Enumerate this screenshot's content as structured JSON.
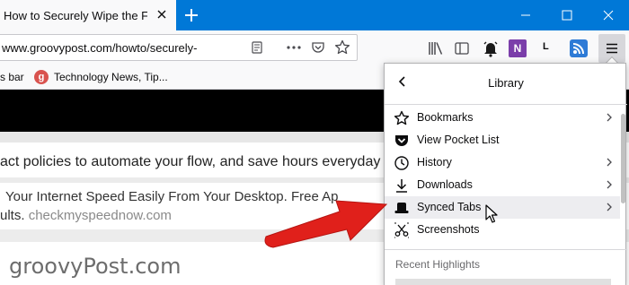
{
  "tab": {
    "title": "How to Securely Wipe the Free"
  },
  "navbar": {
    "url": "www.groovypost.com/howto/securely-"
  },
  "bookmarks": {
    "item1": "s bar",
    "favicon_letter": "g",
    "item2": "Technology News, Tip..."
  },
  "toolbar_icons": {
    "letter_icon": "L",
    "onenote_letter": "N"
  },
  "content": {
    "line_policies": "act policies to automate your flow, and save hours everyday",
    "line_speed": "Your Internet Speed Easily From Your Desktop. Free Ap",
    "line_results_prefix": "ults. ",
    "line_results_link": "checkmyspeednow.com",
    "watermark": "groovyPost.com"
  },
  "library": {
    "title": "Library",
    "items": [
      {
        "label": "Bookmarks",
        "icon": "bookmarks-icon",
        "submenu": true
      },
      {
        "label": "View Pocket List",
        "icon": "pocket-icon",
        "submenu": false
      },
      {
        "label": "History",
        "icon": "history-icon",
        "submenu": true
      },
      {
        "label": "Downloads",
        "icon": "downloads-icon",
        "submenu": true
      },
      {
        "label": "Synced Tabs",
        "icon": "synced-tabs-icon",
        "submenu": true,
        "hovered": true
      },
      {
        "label": "Screenshots",
        "icon": "screenshots-icon",
        "submenu": false
      }
    ],
    "recent_highlights": "Recent Highlights"
  },
  "colors": {
    "titlebar": "#0078d7",
    "toolbar": "#f9f9fa",
    "arrow": "#e0201b",
    "hover": "#ededf0"
  }
}
